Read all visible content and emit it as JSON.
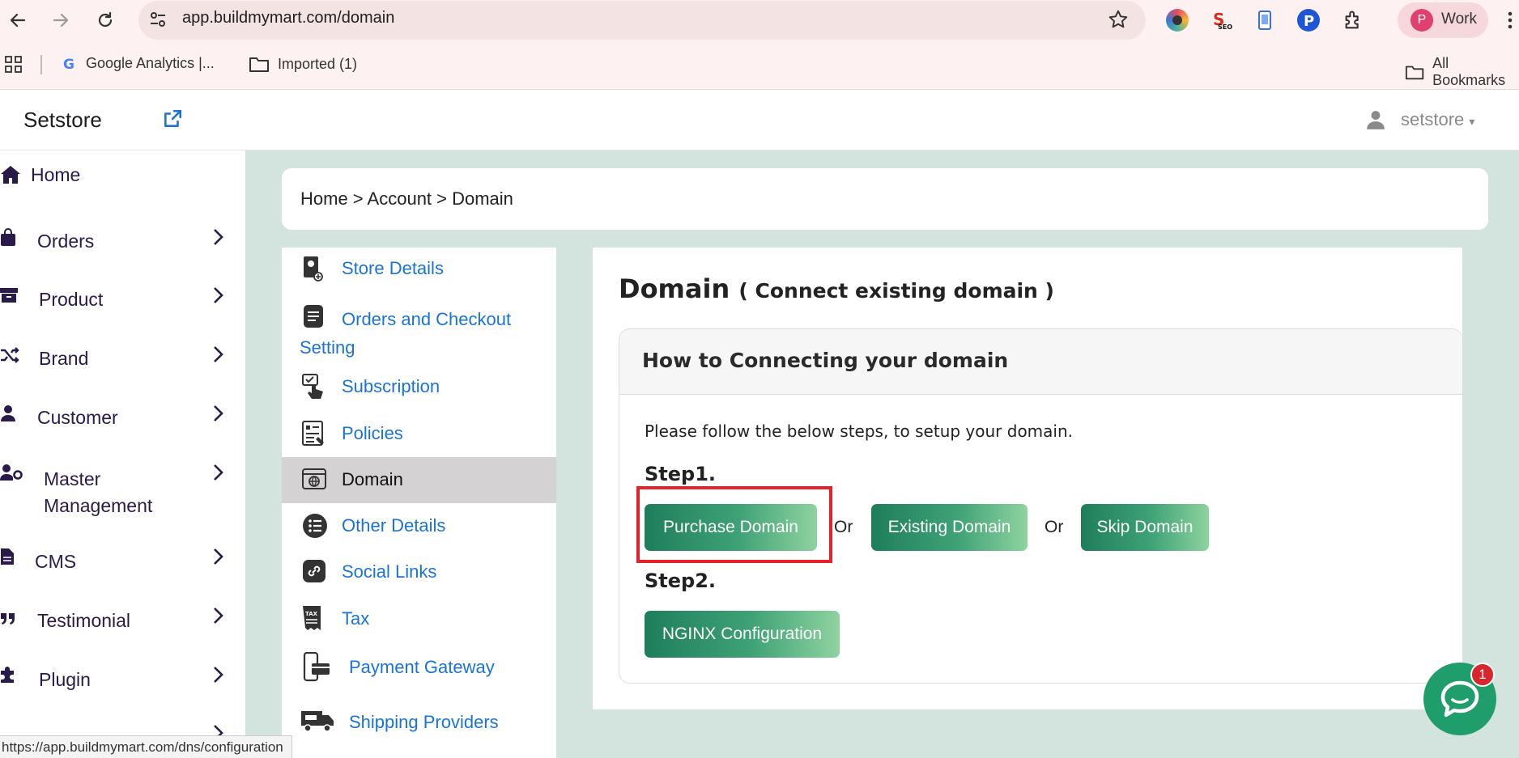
{
  "browser": {
    "url": "app.buildmymart.com/domain",
    "profile_initial": "P",
    "profile_name": "Work",
    "bookmarks": [
      {
        "label": "Google Analytics  |..."
      },
      {
        "label": "Imported (1)"
      },
      {
        "label": "All Bookmarks"
      }
    ],
    "status_url": "https://app.buildmymart.com/dns/configuration"
  },
  "header": {
    "brand": "Setstore",
    "user": "setstore"
  },
  "sidebar": {
    "items": [
      {
        "label": "Home",
        "icon": "home-icon"
      },
      {
        "label": "Orders",
        "icon": "bag-icon"
      },
      {
        "label": "Product",
        "icon": "archive-icon"
      },
      {
        "label": "Brand",
        "icon": "shuffle-icon"
      },
      {
        "label": "Customer",
        "icon": "user-icon"
      },
      {
        "label": "Master Management",
        "icon": "user-gear-icon"
      },
      {
        "label": "CMS",
        "icon": "file-icon"
      },
      {
        "label": "Testimonial",
        "icon": "quote-icon"
      },
      {
        "label": "Plugin",
        "icon": "puzzle-icon"
      }
    ]
  },
  "breadcrumb": "Home > Account > Domain",
  "subnav": {
    "items": [
      {
        "label": "Store Details"
      },
      {
        "label": "Orders and Checkout Setting"
      },
      {
        "label": "Subscription"
      },
      {
        "label": "Policies"
      },
      {
        "label": "Domain"
      },
      {
        "label": "Other Details"
      },
      {
        "label": "Social Links"
      },
      {
        "label": "Tax"
      },
      {
        "label": "Payment Gateway"
      },
      {
        "label": "Shipping Providers"
      }
    ]
  },
  "content": {
    "title": "Domain",
    "subtitle": "( Connect existing domain )",
    "card_title": "How to Connecting your domain",
    "instruction": "Please follow the below steps, to setup your domain.",
    "step1": "Step1.",
    "step2": "Step2.",
    "purchase_btn": "Purchase Domain",
    "existing_btn": "Existing Domain",
    "skip_btn": "Skip Domain",
    "or": "Or",
    "nginx_btn": "NGINX Configuration"
  },
  "chat": {
    "badge": "1"
  },
  "colors": {
    "accent_green": "#1f9d6b",
    "main_bg": "#d3e4df",
    "link_blue": "#1a73d9",
    "highlight_red": "#e3222a"
  }
}
